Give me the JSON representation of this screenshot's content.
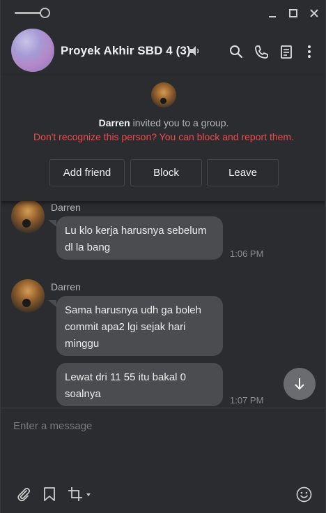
{
  "window": {
    "controls": [
      "minimize-icon",
      "maximize-icon",
      "close-icon"
    ]
  },
  "header": {
    "title": "Proyek Akhir SBD 4 (3)",
    "icons": [
      "speaker-icon",
      "search-icon",
      "phone-icon",
      "notes-icon",
      "more-vertical-icon"
    ]
  },
  "invite": {
    "inviter": "Darren",
    "text": " invited you to a group.",
    "warning": "Don't recognize this person? You can block and report them.",
    "buttons": {
      "add_friend": "Add friend",
      "block": "Block",
      "leave": "Leave"
    }
  },
  "messages": [
    {
      "sender": "Darren",
      "bubbles": [
        {
          "text": "Lu klo kerja harusnya sebelum dl la bang",
          "time": "1:06 PM"
        }
      ]
    },
    {
      "sender": "Darren",
      "bubbles": [
        {
          "text": "Sama harusnya udh ga boleh commit apa2 lgi sejak hari minggu",
          "time": ""
        },
        {
          "text": "Lewat dri 11 55 itu bakal 0 soalnya",
          "time": "1:07 PM"
        }
      ]
    }
  ],
  "composer": {
    "placeholder": "Enter a message",
    "tools": [
      "paperclip-icon",
      "bookmark-icon",
      "crop-icon",
      "emoji-icon"
    ]
  },
  "colors": {
    "background": "#2b2c30",
    "bubble": "#4b4c50",
    "warning": "#f04b4b"
  }
}
